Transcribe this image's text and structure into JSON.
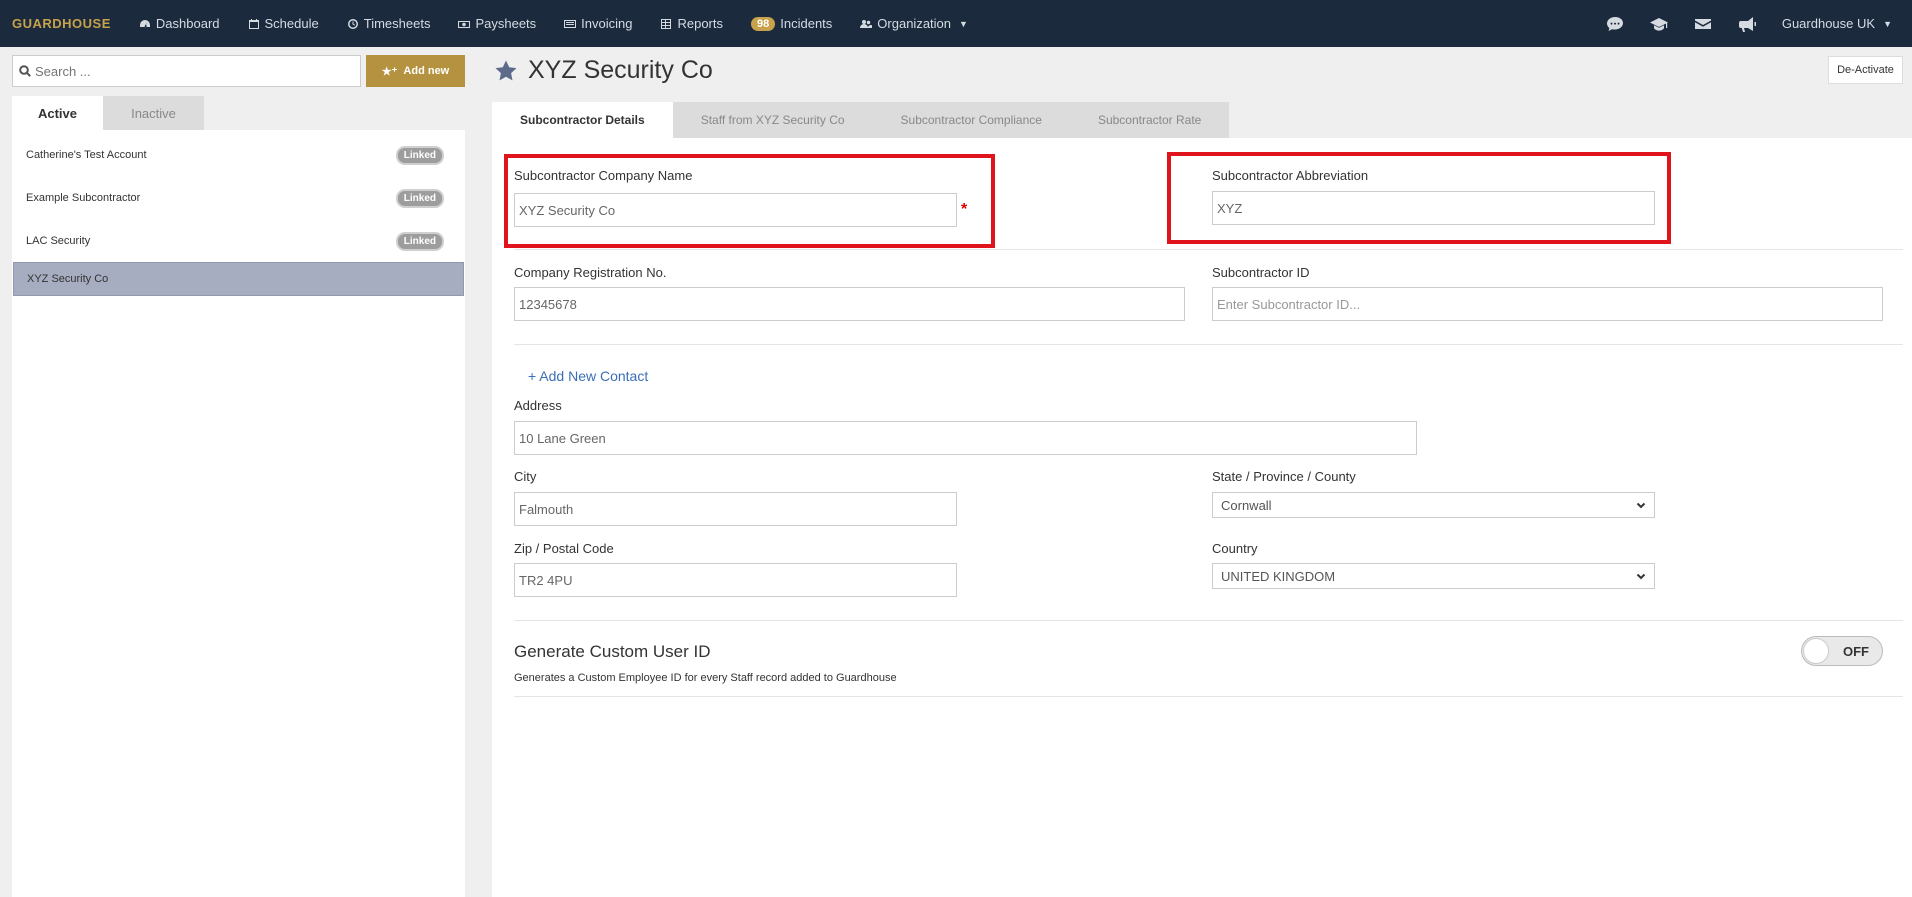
{
  "nav": {
    "logo": "GUARDHOUSE",
    "items": [
      {
        "label": "Dashboard",
        "icon": "dashboard-icon"
      },
      {
        "label": "Schedule",
        "icon": "calendar-icon"
      },
      {
        "label": "Timesheets",
        "icon": "clock-icon"
      },
      {
        "label": "Paysheets",
        "icon": "money-icon"
      },
      {
        "label": "Invoicing",
        "icon": "invoice-icon"
      },
      {
        "label": "Reports",
        "icon": "table-icon"
      },
      {
        "label": "Incidents",
        "badge": "98"
      },
      {
        "label": "Organization",
        "icon": "users-icon"
      }
    ],
    "account": "Guardhouse UK",
    "accent": "#c8a24a",
    "background": "#1b2a3d"
  },
  "sidebar": {
    "search_placeholder": "Search ...",
    "add_label": "Add new",
    "tabs": [
      "Active",
      "Inactive"
    ],
    "items": [
      {
        "name": "Catherine's Test Account",
        "badge": "Linked"
      },
      {
        "name": "Example Subcontractor",
        "badge": "Linked"
      },
      {
        "name": "LAC Security",
        "badge": "Linked"
      },
      {
        "name": "XYZ Security Co",
        "selected": true
      }
    ]
  },
  "main": {
    "title": "XYZ Security Co",
    "deactivate_label": "De-Activate",
    "tabs": [
      "Subcontractor Details",
      "Staff from XYZ Security Co",
      "Subcontractor Compliance",
      "Subcontractor Rate"
    ],
    "form": {
      "company_name_label": "Subcontractor Company Name",
      "company_name_value": "XYZ Security Co",
      "required_mark": "*",
      "abbreviation_label": "Subcontractor Abbreviation",
      "abbreviation_value": "XYZ",
      "reg_no_label": "Company Registration No.",
      "reg_no_value": "12345678",
      "sub_id_label": "Subcontractor ID",
      "sub_id_placeholder": "Enter Subcontractor ID...",
      "add_contact_label": "+ Add New Contact",
      "address_label": "Address",
      "address_value": "10 Lane Green",
      "city_label": "City",
      "city_value": "Falmouth",
      "state_label": "State / Province / County",
      "state_value": "Cornwall",
      "zip_label": "Zip / Postal Code",
      "zip_value": "TR2 4PU",
      "country_label": "Country",
      "country_value": "UNITED KINGDOM",
      "custom_id_title": "Generate Custom User ID",
      "custom_id_desc": "Generates a Custom Employee ID for every Staff record added to Guardhouse",
      "toggle_label": "OFF"
    }
  }
}
